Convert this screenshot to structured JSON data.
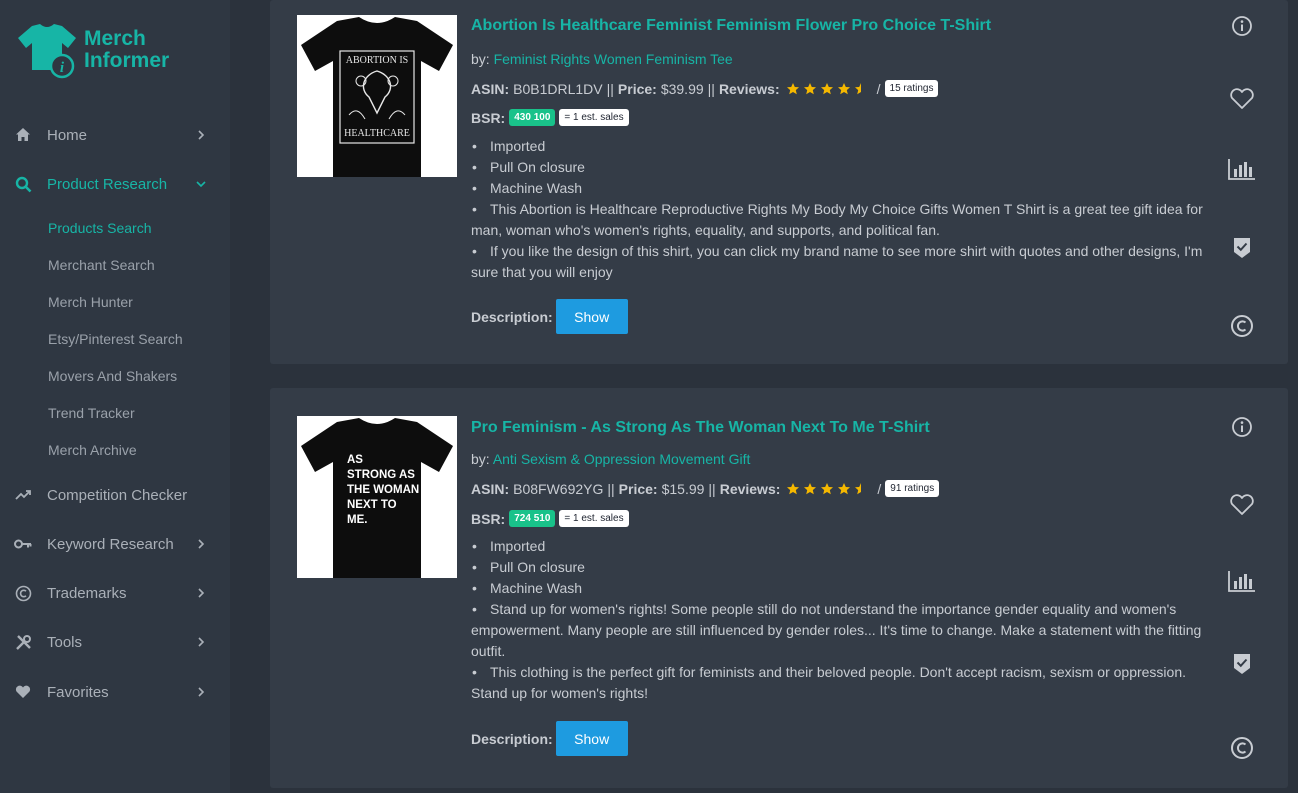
{
  "brand": {
    "line1": "Merch",
    "line2": "Informer",
    "accent": "#17b5a6"
  },
  "sidebar": {
    "items": [
      {
        "label": "Home",
        "icon": "home-icon"
      },
      {
        "label": "Product Research",
        "icon": "search-icon"
      },
      {
        "label": "Competition Checker",
        "icon": "trending-icon"
      },
      {
        "label": "Keyword Research",
        "icon": "key-icon"
      },
      {
        "label": "Trademarks",
        "icon": "copyright-icon"
      },
      {
        "label": "Tools",
        "icon": "tools-icon"
      },
      {
        "label": "Favorites",
        "icon": "heart-icon"
      }
    ],
    "sub_items": [
      "Products Search",
      "Merchant Search",
      "Merch Hunter",
      "Etsy/Pinterest Search",
      "Movers And Shakers",
      "Trend Tracker",
      "Merch Archive"
    ]
  },
  "labels": {
    "by": "by:",
    "asin": "ASIN:",
    "price": "Price:",
    "reviews": "Reviews:",
    "bsr": "BSR:",
    "description": "Description:",
    "show": "Show",
    "sep": "||",
    "slash": "/"
  },
  "products": [
    {
      "title": "Abortion Is Healthcare Feminist Feminism Flower Pro Choice T-Shirt",
      "brand": "Feminist Rights Women Feminism Tee",
      "asin": "B0B1DRL1DV",
      "price": "$39.99",
      "rating": 4.5,
      "ratings_count": "15 ratings",
      "bsr": "430 100",
      "est_sales": "= 1 est. sales",
      "shirt_text_lines": [
        "ABORTION IS",
        "HEALTHCARE"
      ],
      "bullets": [
        "Imported",
        "Pull On closure",
        "Machine Wash",
        "This Abortion is Healthcare Reproductive Rights My Body My Choice Gifts Women T Shirt is a great tee gift idea for man, woman who's women's rights, equality, and supports, and political fan.",
        "If you like the design of this shirt, you can click my brand name to see more shirt with quotes and other designs, I'm sure that you will enjoy"
      ]
    },
    {
      "title": "Pro Feminism - As Strong As The Woman Next To Me T-Shirt",
      "brand": "Anti Sexism & Oppression Movement Gift",
      "asin": "B08FW692YG",
      "price": "$15.99",
      "rating": 4.5,
      "ratings_count": "91 ratings",
      "bsr": "724 510",
      "est_sales": "= 1 est. sales",
      "shirt_text_lines": [
        "AS",
        "STRONG AS",
        "THE WOMAN",
        "NEXT TO",
        "ME."
      ],
      "bullets": [
        "Imported",
        "Pull On closure",
        "Machine Wash",
        "Stand up for women's rights! Some people still do not understand the importance gender equality and women's empowerment. Many people are still influenced by gender roles... It's time to change. Make a statement with the fitting outfit.",
        "This clothing is the perfect gift for feminists and their beloved people. Don't accept racism, sexism or oppression. Stand up for women's rights!"
      ]
    }
  ],
  "colors": {
    "background": "#2b323c",
    "sidebar": "#2f3742",
    "card": "#343c47",
    "accent": "#17b5a6",
    "button": "#1e9be0",
    "bsr_badge": "#19c28a",
    "star": "#f5b800"
  }
}
